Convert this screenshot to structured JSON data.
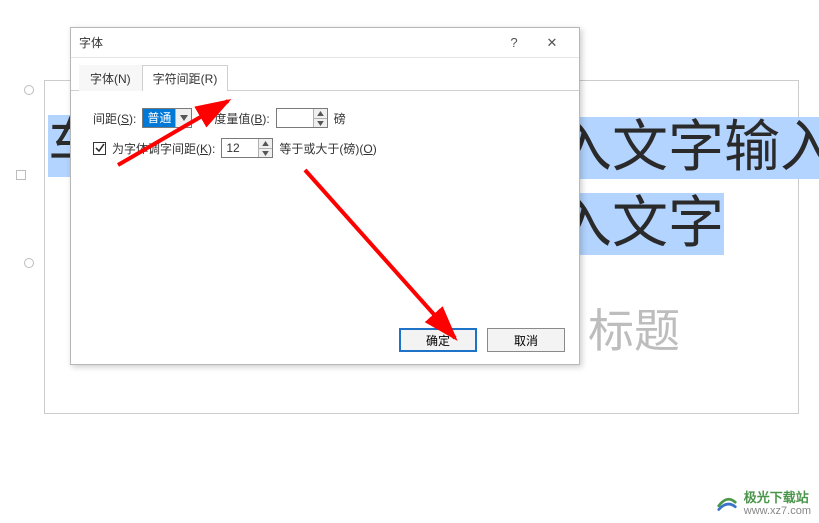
{
  "dialog": {
    "title": "字体",
    "help": "?",
    "close": "✕",
    "tabs": {
      "font": "字体(N)",
      "spacing": "字符间距(R)"
    },
    "spacing": {
      "spacing_label_pre": "间距(",
      "spacing_label_u": "S",
      "spacing_label_post": "):",
      "spacing_value": "普通",
      "measure_label_pre": "度量值(",
      "measure_label_u": "B",
      "measure_label_post": "):",
      "measure_value": "",
      "measure_unit": "磅",
      "kerning_checked": true,
      "kerning_label_pre": "为字体调",
      "kerning_label_mid": "字间距(",
      "kerning_label_u": "K",
      "kerning_label_post": "):",
      "kerning_value": "12",
      "kerning_tail_pre": "等于或大于(磅)(",
      "kerning_tail_u": "O",
      "kerning_tail_post": ")"
    },
    "buttons": {
      "ok": "确定",
      "cancel": "取消"
    }
  },
  "canvas": {
    "text_line1_visible": "入文字输入",
    "text_line2_visible": "入文字",
    "title_text": "标题",
    "left_char": "车"
  },
  "watermark": {
    "name": "极光下载站",
    "url": "www.xz7.com"
  }
}
